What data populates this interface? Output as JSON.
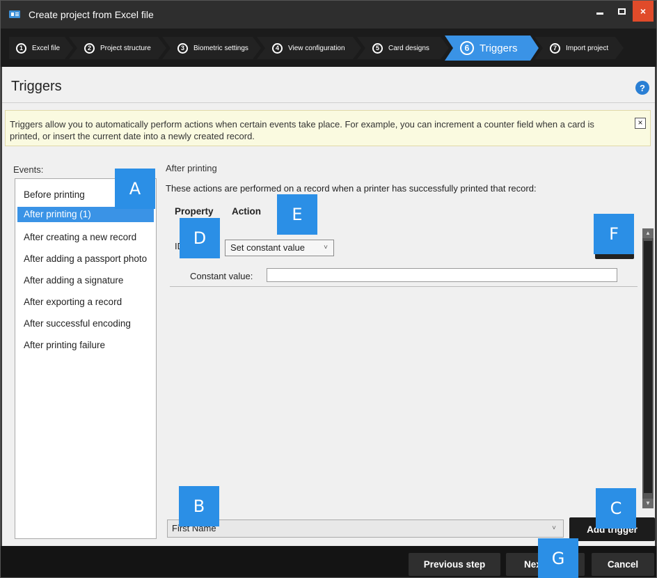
{
  "window": {
    "title": "Create project from Excel file",
    "accent": "#3a93e6",
    "close_glyph": "×"
  },
  "steps": [
    {
      "num": "1",
      "label": "Excel file"
    },
    {
      "num": "2",
      "label": "Project structure"
    },
    {
      "num": "3",
      "label": "Biometric settings"
    },
    {
      "num": "4",
      "label": "View configuration"
    },
    {
      "num": "5",
      "label": "Card designs"
    },
    {
      "num": "6",
      "label": "Triggers",
      "active": true
    },
    {
      "num": "7",
      "label": "Import project"
    }
  ],
  "page": {
    "title": "Triggers",
    "help_glyph": "?"
  },
  "info": {
    "text": "Triggers allow you to automatically perform actions when certain events take place. For example, you can increment a counter field when a card is printed, or insert the current date into a newly created record.",
    "close_glyph": "×"
  },
  "events": {
    "label": "Events:",
    "items": [
      "Before printing",
      "After printing (1)",
      "After creating a new record",
      "After adding a passport photo",
      "After adding a signature",
      "After exporting a record",
      "After successful encoding",
      "After printing failure"
    ],
    "selected_index": 1
  },
  "detail": {
    "title": "After printing",
    "description": "These actions are performed on a record when a printer has successfully printed that record:",
    "col_property": "Property",
    "col_action": "Action",
    "trigger": {
      "property": "ID",
      "action": "Set constant value",
      "constant_label": "Constant value:",
      "constant_value": ""
    }
  },
  "footer": {
    "field_select": "First Name",
    "add_trigger": "Add trigger"
  },
  "buttons": {
    "previous": "Previous step",
    "next": "Next",
    "cancel": "Cancel"
  },
  "callouts": [
    "A",
    "B",
    "C",
    "D",
    "E",
    "F",
    "G"
  ],
  "icons": {
    "chevron": "˅",
    "scroll_up": "▲",
    "scroll_down": "▼"
  }
}
